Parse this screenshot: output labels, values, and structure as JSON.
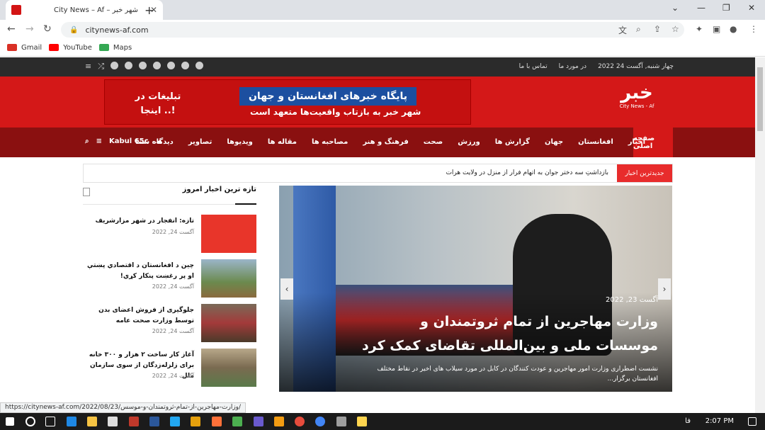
{
  "browser": {
    "tab_title": "City News – Af – شهر خبر",
    "tab_close": "✕",
    "new_tab": "+",
    "url": "citynews-af.com",
    "bookmarks": [
      {
        "label": "Gmail",
        "color": "#d93025"
      },
      {
        "label": "YouTube",
        "color": "#ff0000"
      },
      {
        "label": "Maps",
        "color": "#34a853"
      }
    ],
    "status_url": "https://citynews-af.com/2022/08/23/وزارت-مهاجرین-از-تمام-ثروتمندان-و-موسس/"
  },
  "site": {
    "topbar": {
      "date": "چهار شنبه, آگست 24 2022",
      "about": "در مورد ما",
      "contact": "تماس با ما"
    },
    "banner": {
      "main": "پایگاه خبرهای افغانستان و جهان",
      "sub": "شهر خبر به بازتاب واقعیت‌ها متعهد است",
      "ad": "تبلیغات در اینجا ..!"
    },
    "logo": {
      "text": "خبر",
      "sub": "City News - Af"
    },
    "nav": {
      "home": "صفحه اصلی",
      "items": [
        "اخبار",
        "افغانستان",
        "جهان",
        "گزارش ها",
        "ورزش",
        "صحت",
        "فرهنگ و هنر",
        "مصاحبه ها",
        "مقاله ها",
        "ویدیوها",
        "تصاویر",
        "دیدگاه شما"
      ],
      "weather": "Kabul 65c"
    },
    "ticker": {
      "label": "جدیدترین اخبار",
      "text": "بازداشتِ سه دختر جوان به اتهام فرار از منزل در ولایت هرات"
    },
    "slider": {
      "date": "آگست 23, 2022",
      "title": "وزارت مهاجرین از تمام ثروتمندان و موسسات ملی و بین‌المللی تقاضای کمک کرد",
      "desc": "نشست اضطراری وزارت امور مهاجرین و عودت کنندگان در کابل در مورد سیلاب های اخیر در نقاط مختلف افغانستان برگزار...",
      "prev": "‹",
      "next": "›"
    },
    "sidebar": {
      "heading": "تازه ترین اخبار امروز",
      "posts": [
        {
          "title": "تازه: انفجار در شهر مزارشریف",
          "date": "آگست 24, 2022"
        },
        {
          "title": "چین د افغانستان د اقتصادي پښتې او پر رغښت پنکار کړي!",
          "date": "آگست 24, 2022"
        },
        {
          "title": "جلوگیری از فروش اعضای بدن توسط وزارت صحت عامه",
          "date": "آگست 24, 2022"
        },
        {
          "title": "آغاز کار ساخت ۲ هزار و ۳۰۰ خانه برای زلزله‌زدگان از سوی سازمان ملل",
          "date": "آگست 24, 2022"
        }
      ]
    }
  },
  "taskbar": {
    "time": "2:07 PM",
    "lang": "فا"
  }
}
